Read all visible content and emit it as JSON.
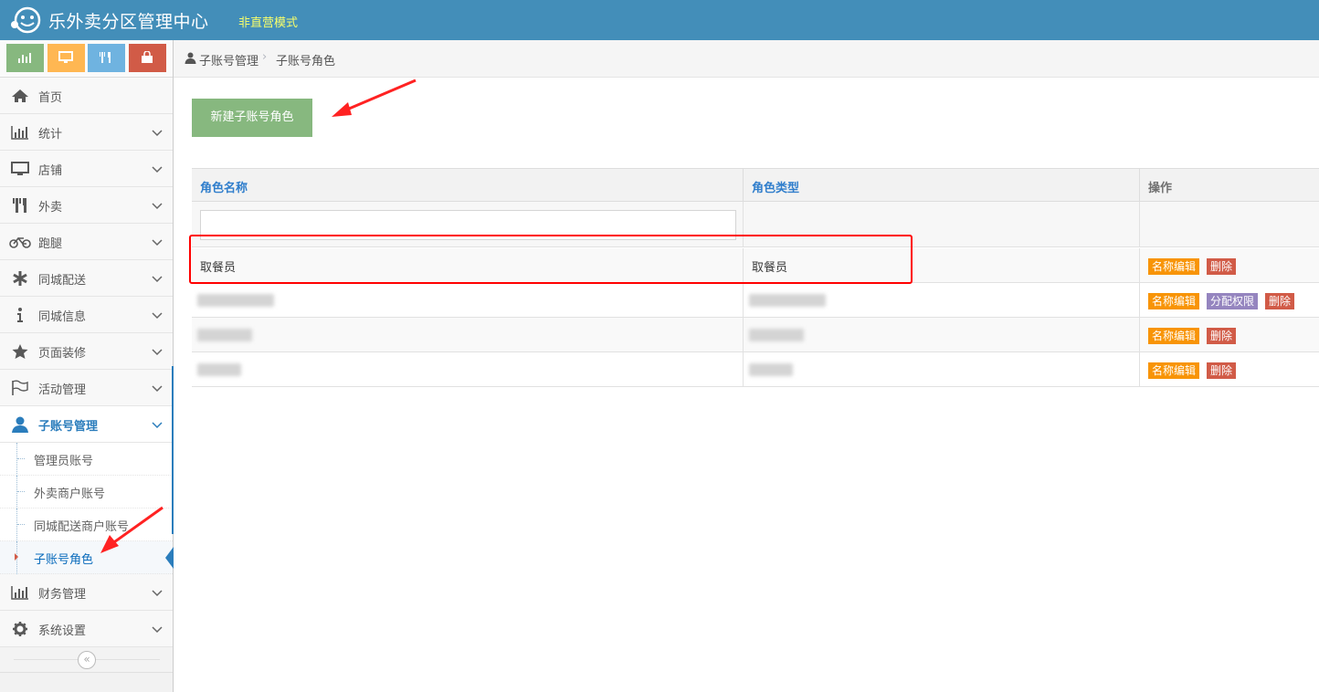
{
  "header": {
    "brand": "乐外卖分区管理中心",
    "mode": "非直营模式"
  },
  "shortcuts": [
    {
      "icon": "bar-chart-icon",
      "color": "#87b87f"
    },
    {
      "icon": "monitor-icon",
      "color": "#ffb752"
    },
    {
      "icon": "cutlery-icon",
      "color": "#6fb3e0"
    },
    {
      "icon": "shopping-bag-icon",
      "color": "#d15b47"
    }
  ],
  "sidebar": {
    "items": [
      {
        "label": "首页",
        "icon": "home-icon"
      },
      {
        "label": "统计",
        "icon": "bar-chart-icon"
      },
      {
        "label": "店铺",
        "icon": "monitor-icon"
      },
      {
        "label": "外卖",
        "icon": "cutlery-icon"
      },
      {
        "label": "跑腿",
        "icon": "bicycle-icon"
      },
      {
        "label": "同城配送",
        "icon": "asterisk-icon"
      },
      {
        "label": "同城信息",
        "icon": "info-icon"
      },
      {
        "label": "页面装修",
        "icon": "star-icon"
      },
      {
        "label": "活动管理",
        "icon": "flag-icon"
      },
      {
        "label": "子账号管理",
        "icon": "user-icon"
      },
      {
        "label": "财务管理",
        "icon": "bar-chart-icon"
      },
      {
        "label": "系统设置",
        "icon": "gear-icon"
      }
    ],
    "subitems": [
      {
        "label": "管理员账号"
      },
      {
        "label": "外卖商户账号"
      },
      {
        "label": "同城配送商户账号"
      },
      {
        "label": "子账号角色"
      }
    ],
    "collapse_symbol": "«"
  },
  "breadcrumb": {
    "parent": "子账号管理",
    "separator": "›",
    "current": "子账号角色"
  },
  "toolbar": {
    "new_role_label": "新建子账号角色"
  },
  "table": {
    "columns": [
      "角色名称",
      "角色类型",
      "操作"
    ],
    "rows": [
      {
        "name": "取餐员",
        "type": "取餐员",
        "actions": [
          "名称编辑",
          "删除"
        ]
      },
      {
        "name": "",
        "type": "",
        "actions": [
          "名称编辑",
          "分配权限",
          "删除"
        ]
      },
      {
        "name": "",
        "type": "",
        "actions": [
          "名称编辑",
          "删除"
        ]
      },
      {
        "name": "",
        "type": "",
        "actions": [
          "名称编辑",
          "删除"
        ]
      }
    ]
  },
  "colors": {
    "navbar": "#438eb9",
    "accent": "#2b7dbc",
    "success": "#87b87f",
    "warning": "#f89406",
    "danger": "#d15b47",
    "purple": "#9585bf",
    "annotation": "#ff0000"
  }
}
